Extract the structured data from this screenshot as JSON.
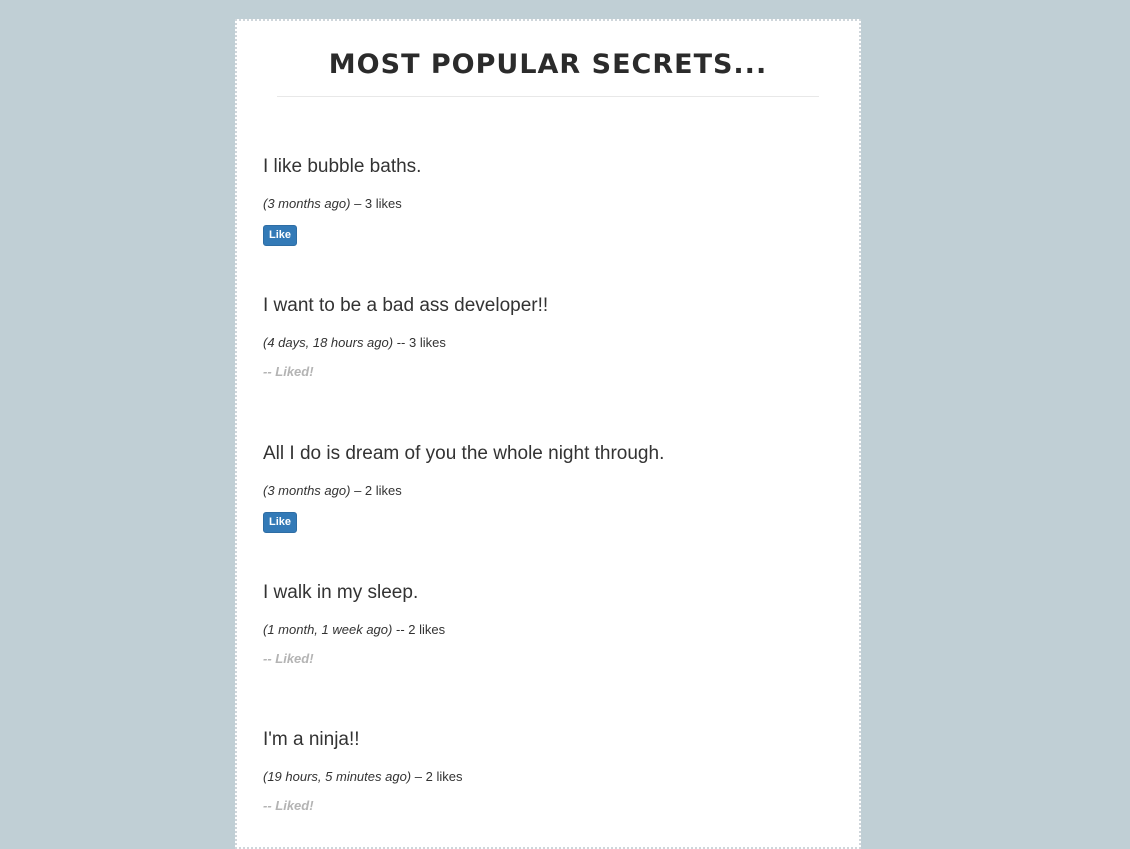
{
  "page": {
    "title": "MOST POPULAR SECRETS..."
  },
  "secrets": [
    {
      "text": "I like bubble baths.",
      "age": "(3 months ago)",
      "likes": "– 3 likes",
      "action": "Like"
    },
    {
      "text": "I want to be a bad ass developer!!",
      "age": "(4 days, 18 hours ago)",
      "likes": "-- 3 likes",
      "liked": "-- Liked!"
    },
    {
      "text": "All I do is dream of you the whole night through.",
      "age": "(3 months ago)",
      "likes": "– 2 likes",
      "action": "Like"
    },
    {
      "text": "I walk in my sleep.",
      "age": "(1 month, 1 week ago)",
      "likes": "-- 2 likes",
      "liked": "-- Liked!"
    },
    {
      "text": "I'm a ninja!!",
      "age": "(19 hours, 5 minutes ago)",
      "likes": "– 2 likes",
      "liked": "-- Liked!"
    }
  ],
  "colors": {
    "background": "#c0cfd5",
    "panel": "#ffffff",
    "button": "#337ab7",
    "liked_text": "#b4b4b4"
  }
}
